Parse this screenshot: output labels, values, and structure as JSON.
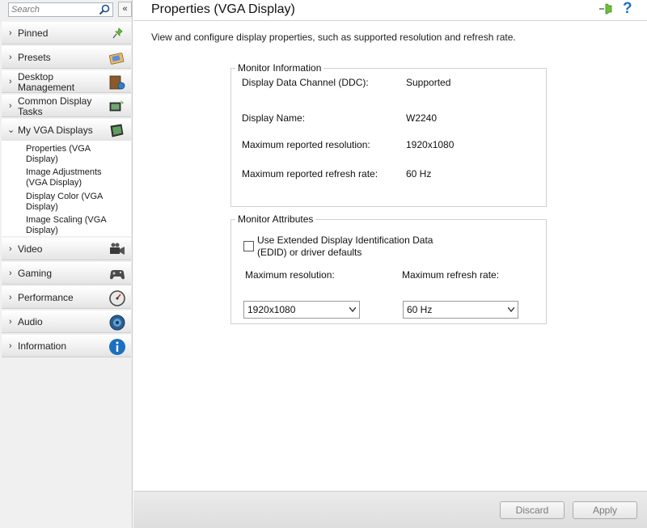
{
  "search": {
    "placeholder": "Search"
  },
  "sidebar": {
    "collapse_label": "«",
    "items": [
      {
        "label": "Pinned",
        "icon": "pin-icon"
      },
      {
        "label": "Presets",
        "icon": "presets-icon"
      },
      {
        "label": "Desktop Management",
        "icon": "desktop-management-icon"
      },
      {
        "label": "Common Display Tasks",
        "icon": "display-tasks-icon"
      },
      {
        "label": "My VGA Displays",
        "icon": "monitor-icon"
      },
      {
        "label": "Video",
        "icon": "video-camera-icon"
      },
      {
        "label": "Gaming",
        "icon": "gamepad-icon"
      },
      {
        "label": "Performance",
        "icon": "gauge-icon"
      },
      {
        "label": "Audio",
        "icon": "speaker-icon"
      },
      {
        "label": "Information",
        "icon": "info-icon"
      }
    ],
    "subitems": [
      "Properties (VGA Display)",
      "Image Adjustments (VGA Display)",
      "Display Color (VGA Display)",
      "Image Scaling (VGA Display)"
    ]
  },
  "header": {
    "title": "Properties (VGA Display)",
    "help": "?"
  },
  "main": {
    "description": "View and configure display properties, such as supported resolution and refresh rate.",
    "monitor_info": {
      "legend": "Monitor Information",
      "rows": [
        {
          "label": "Display Data Channel (DDC):",
          "value": "Supported"
        },
        {
          "label": "Display Name:",
          "value": "W2240"
        },
        {
          "label": "Maximum reported resolution:",
          "value": "1920x1080"
        },
        {
          "label": "Maximum reported refresh rate:",
          "value": "60 Hz"
        }
      ]
    },
    "monitor_attributes": {
      "legend": "Monitor Attributes",
      "edid_label": "Use Extended Display Identification Data (EDID) or driver defaults",
      "edid_checked": false,
      "max_resolution_label": "Maximum resolution:",
      "max_resolution_value": "1920x1080",
      "max_refresh_label": "Maximum refresh rate:",
      "max_refresh_value": "60 Hz"
    }
  },
  "footer": {
    "discard_label": "Discard",
    "apply_label": "Apply"
  },
  "colors": {
    "accent": "#1d6fc0",
    "sidebar_bg": "#f0f0f0"
  }
}
